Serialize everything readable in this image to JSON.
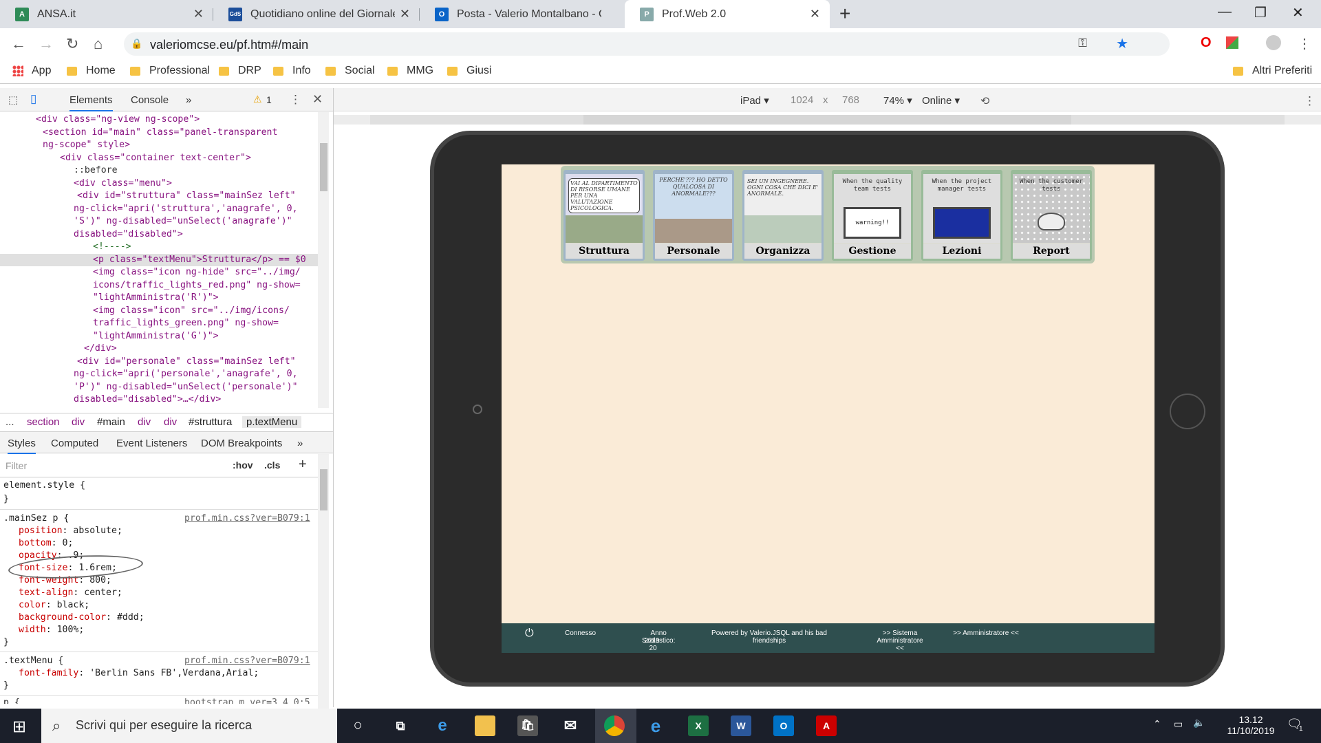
{
  "browser": {
    "tabs": [
      {
        "title": "ANSA.it",
        "icon": "A"
      },
      {
        "title": "Quotidiano online del Giornale di",
        "icon": "GdS"
      },
      {
        "title": "Posta - Valerio Montalbano - Out",
        "icon": "O"
      },
      {
        "title": "Prof.Web 2.0",
        "icon": "P"
      }
    ],
    "url": "valeriomcse.eu/pf.htm#/main",
    "bookmarks": [
      "App",
      "Home",
      "Professional",
      "DRP",
      "Info",
      "Social",
      "MMG",
      "Giusi"
    ],
    "other_bookmarks": "Altri Preferiti"
  },
  "devtools": {
    "tabs": [
      "Elements",
      "Console",
      "»"
    ],
    "warning_count": "1",
    "breadcrumbs": [
      "...",
      "section",
      "div",
      "#main",
      "div",
      "div",
      "#struttura",
      "p.textMenu"
    ],
    "styles_tabs": [
      "Styles",
      "Computed",
      "Event Listeners",
      "DOM Breakpoints",
      "»"
    ],
    "filter_placeholder": "Filter",
    "hov": ":hov",
    "cls": ".cls",
    "element_style": "element.style {",
    "close_brace": "}",
    "rule1_selector": ".mainSez p {",
    "rule1_source": "prof.min.css?ver=B079:1",
    "rule1_props": [
      [
        "position",
        "absolute;"
      ],
      [
        "bottom",
        "0;"
      ],
      [
        "opacity",
        ".9;"
      ],
      [
        "font-size",
        "1.6rem;"
      ],
      [
        "font-weight",
        "800;"
      ],
      [
        "text-align",
        "center;"
      ],
      [
        "color",
        "black;"
      ],
      [
        "background-color",
        "#ddd;"
      ],
      [
        "width",
        "100%;"
      ]
    ],
    "rule2_selector": ".textMenu {",
    "rule2_source": "prof.min.css?ver=B079:1",
    "rule2_prop": [
      "font-family",
      "'Berlin Sans FB',Verdana,Arial;"
    ],
    "rule3_partial": "p {",
    "rule3_source": "bootstrap.m.ver=3.4.0:5"
  },
  "dom_lines": [
    "<div class=\"ng-view ng-scope\">",
    "<section id=\"main\" class=\"panel-transparent",
    "ng-scope\" style>",
    "<div class=\"container text-center\">",
    "::before",
    "<div class=\"menu\">",
    "<div id=\"struttura\" class=\"mainSez left\"",
    "ng-click=\"apri('struttura','anagrafe', 0,",
    "'S')\" ng-disabled=\"unSelect('anagrafe')\"",
    "disabled=\"disabled\">",
    "<!---->",
    "<p class=\"textMenu\">Struttura</p> == $0",
    "<img class=\"icon ng-hide\" src=\"../img/",
    "icons/traffic_lights_red.png\" ng-show=",
    "\"lightAmministra('R')\">",
    "<img class=\"icon\" src=\"../img/icons/",
    "traffic_lights_green.png\" ng-show=",
    "\"lightAmministra('G')\">",
    "</div>",
    "<div id=\"personale\" class=\"mainSez left\"",
    "ng-click=\"apri('personale','anagrafe', 0,",
    "'P')\" ng-disabled=\"unSelect('personale')\"",
    "disabled=\"disabled\">…</div>"
  ],
  "device_toolbar": {
    "device": "iPad ▾",
    "width": "1024",
    "times": "x",
    "height": "768",
    "zoom": "74% ▾",
    "network": "Online ▾"
  },
  "app": {
    "menu_cards": [
      {
        "label": "Struttura",
        "caption": "VAI AL DIPARTIMENTO DI RISORSE UMANE PER UNA VALUTAZIONE PSICOLOGICA."
      },
      {
        "label": "Personale",
        "caption": "PERCHE'??? HO DETTO QUALCOSA DI ANORMALE???"
      },
      {
        "label": "Organizza",
        "caption": "SEI UN INGEGNERE. OGNI COSA CHE DICI E' ANORMALE."
      },
      {
        "label": "Gestione",
        "caption": "When the quality team tests"
      },
      {
        "label": "Lezioni",
        "caption": "When the project manager tests"
      },
      {
        "label": "Report",
        "caption": "When the customer tests"
      }
    ],
    "warning_text": "warning!!",
    "footer": {
      "status": "Connesso",
      "year_label": "Anno Scolastico:",
      "year": "2019-20",
      "powered": "Powered by Valerio.JSQL and his bad friendships",
      "sistema": ">> Sistema Amministratore <<",
      "admin": ">> Amministratore <<"
    }
  },
  "taskbar": {
    "search_placeholder": "Scrivi qui per eseguire la ricerca",
    "time": "13.12",
    "date": "11/10/2019",
    "notif_count": "1"
  },
  "colors": {
    "accent": "#1a73e8",
    "app_background": "#faebd7",
    "footer": "#2f4f4f"
  }
}
